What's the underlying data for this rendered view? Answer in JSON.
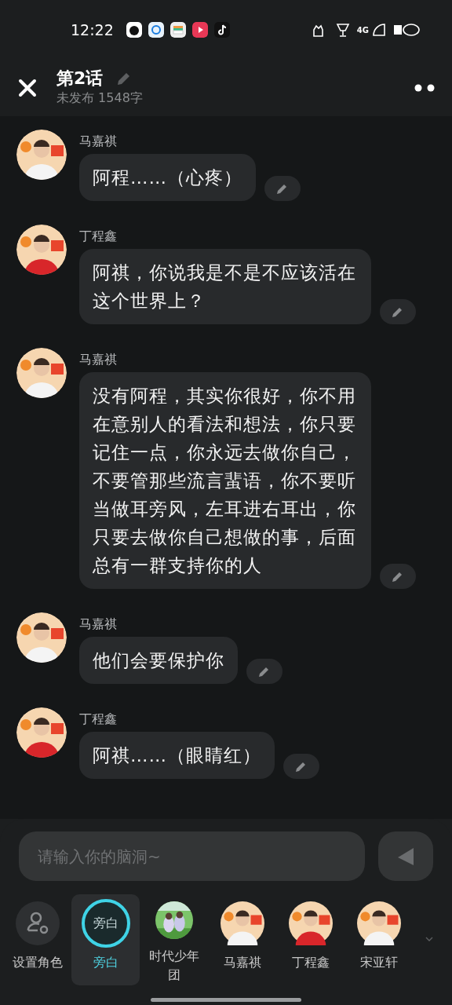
{
  "status_bar": {
    "time": "12:22",
    "network": "4G"
  },
  "header": {
    "title": "第2话",
    "subtitle": "未发布 1548字"
  },
  "messages": [
    {
      "speaker": "马嘉祺",
      "text": "阿程……（心疼）"
    },
    {
      "speaker": "丁程鑫",
      "text": "阿祺，你说我是不是不应该活在这个世界上？"
    },
    {
      "speaker": "马嘉祺",
      "text": "没有阿程，其实你很好，你不用在意别人的看法和想法，你只要记住一点，你永远去做你自己，不要管那些流言蜚语，你不要听当做耳旁风，左耳进右耳出，你只要去做你自己想做的事，后面总有一群支持你的人"
    },
    {
      "speaker": "马嘉祺",
      "text": "他们会要保护你"
    },
    {
      "speaker": "丁程鑫",
      "text": "阿祺……（眼睛红）"
    }
  ],
  "input": {
    "placeholder": "请输入你的脑洞~"
  },
  "characters": [
    {
      "kind": "setup",
      "label": "设置角色",
      "selected": false
    },
    {
      "kind": "narrator",
      "label": "旁白",
      "badge": "旁白",
      "selected": true
    },
    {
      "kind": "group",
      "label": "时代少年团",
      "selected": false
    },
    {
      "kind": "avatar",
      "label": "马嘉祺",
      "selected": false
    },
    {
      "kind": "avatar",
      "label": "丁程鑫",
      "selected": false
    },
    {
      "kind": "avatar",
      "label": "宋亚轩",
      "selected": false
    }
  ]
}
